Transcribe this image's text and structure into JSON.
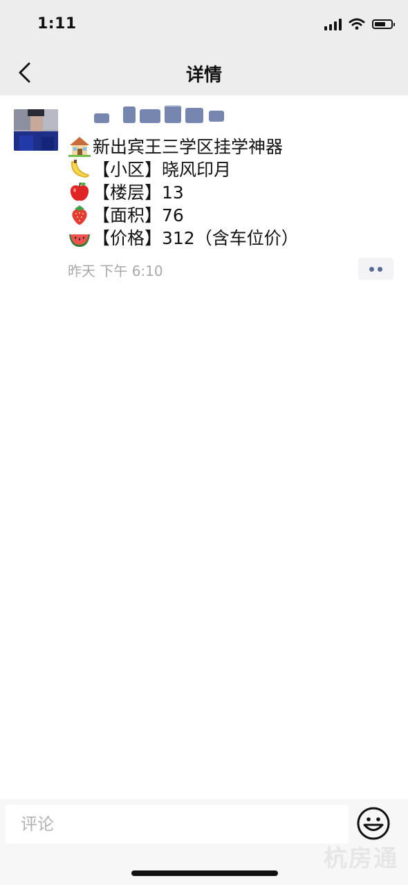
{
  "status_bar": {
    "time": "1:11"
  },
  "nav": {
    "title": "详情"
  },
  "post": {
    "lines": [
      {
        "emoji": "house-icon",
        "text": "新出宾王三学区挂学神器"
      },
      {
        "emoji": "banana-icon",
        "text": "【小区】晓风印月"
      },
      {
        "emoji": "apple-icon",
        "text": "【楼层】13"
      },
      {
        "emoji": "strawberry-icon",
        "text": "【面积】76"
      },
      {
        "emoji": "watermelon-icon",
        "text": "【价格】312（含车位价）"
      }
    ],
    "time": "昨天 下午 6:10"
  },
  "comment": {
    "placeholder": "评论"
  },
  "watermark": "杭房通",
  "colors": {
    "nav_bg": "#ededed",
    "link_blue": "#576b95",
    "meta_gray": "#a8a8a8"
  }
}
